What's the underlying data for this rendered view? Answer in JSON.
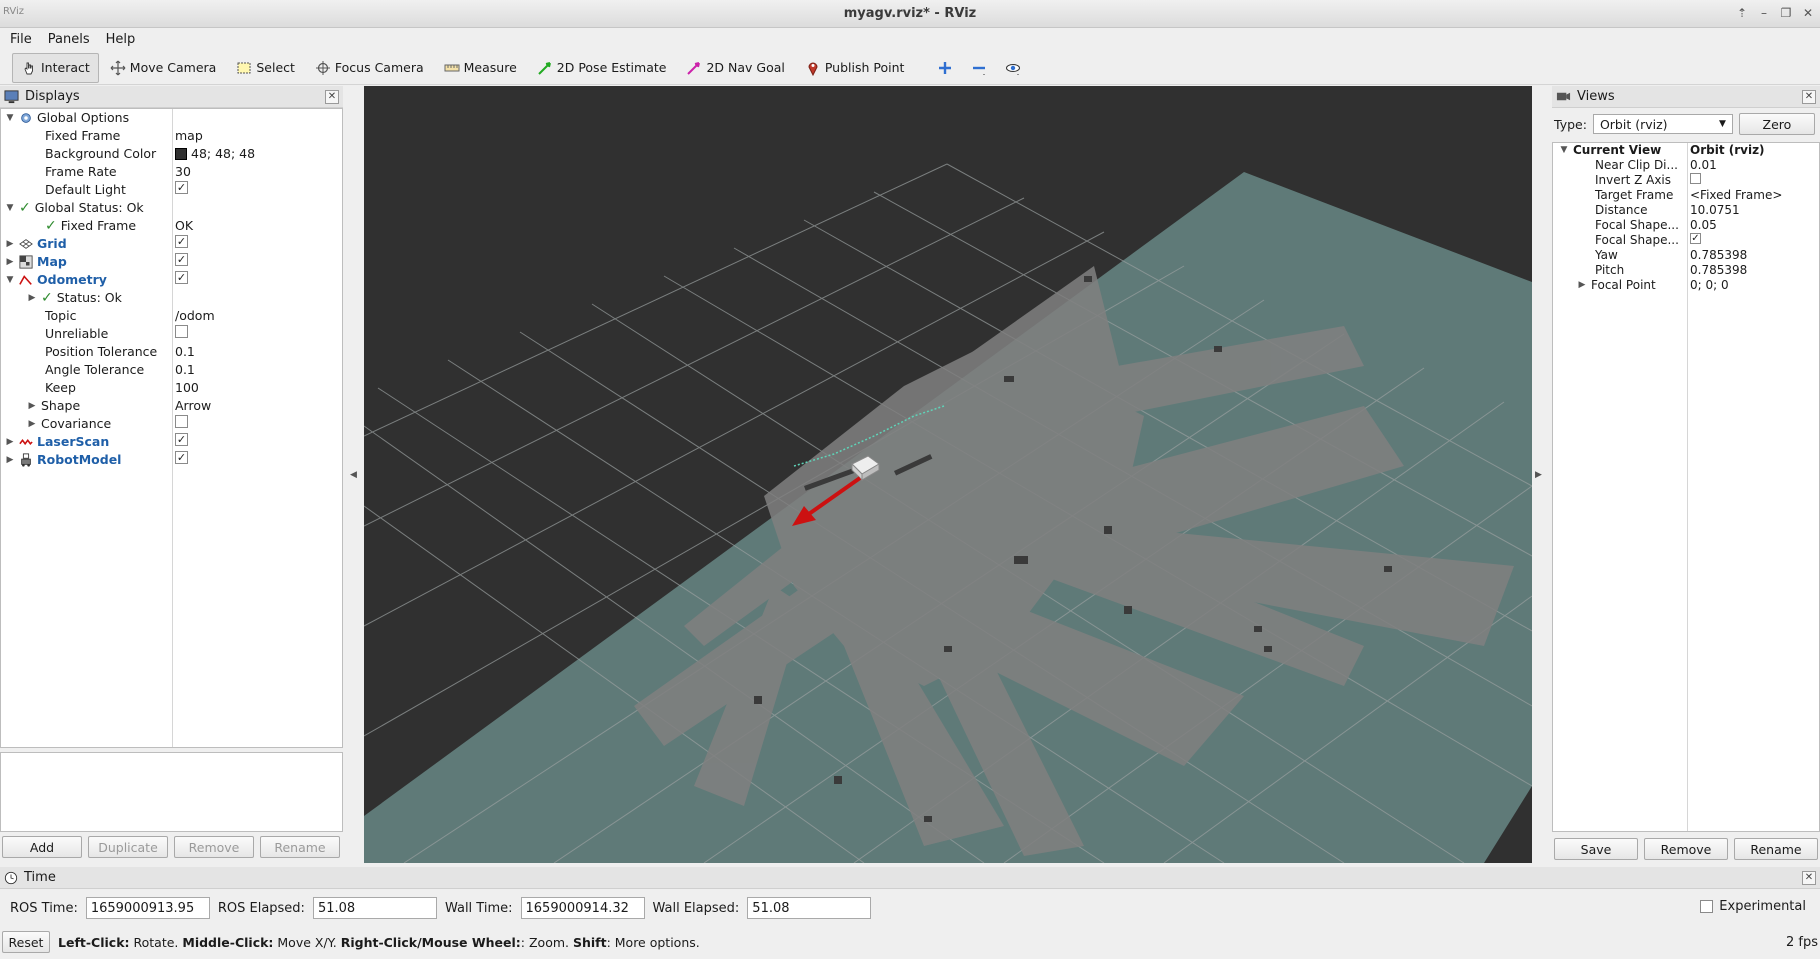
{
  "window": {
    "title": "myagv.rviz* - RViz",
    "app_icon_text": "RViz"
  },
  "menu": [
    "File",
    "Panels",
    "Help"
  ],
  "toolbar": {
    "tools": [
      {
        "label": "Interact",
        "icon": "hand-cursor-icon",
        "active": true
      },
      {
        "label": "Move Camera",
        "icon": "move-camera-icon"
      },
      {
        "label": "Select",
        "icon": "select-box-icon"
      },
      {
        "label": "Focus Camera",
        "icon": "focus-crosshair-icon"
      },
      {
        "label": "Measure",
        "icon": "ruler-icon"
      },
      {
        "label": "2D Pose Estimate",
        "icon": "green-arrow-icon"
      },
      {
        "label": "2D Nav Goal",
        "icon": "magenta-arrow-icon"
      },
      {
        "label": "Publish Point",
        "icon": "map-pin-icon"
      }
    ]
  },
  "displays": {
    "title": "Displays",
    "rows": [
      {
        "label": "Global Options",
        "value": ""
      },
      {
        "label": "Fixed Frame",
        "value": "map"
      },
      {
        "label": "Background Color",
        "value": "48; 48; 48"
      },
      {
        "label": "Frame Rate",
        "value": "30"
      },
      {
        "label": "Default Light",
        "value": ""
      },
      {
        "label": "Global Status: Ok",
        "value": ""
      },
      {
        "label": "Fixed Frame",
        "value": "OK"
      },
      {
        "label": "Grid",
        "value": ""
      },
      {
        "label": "Map",
        "value": ""
      },
      {
        "label": "Odometry",
        "value": ""
      },
      {
        "label": "Status: Ok",
        "value": ""
      },
      {
        "label": "Topic",
        "value": "/odom"
      },
      {
        "label": "Unreliable",
        "value": ""
      },
      {
        "label": "Position Tolerance",
        "value": "0.1"
      },
      {
        "label": "Angle Tolerance",
        "value": "0.1"
      },
      {
        "label": "Keep",
        "value": "100"
      },
      {
        "label": "Shape",
        "value": "Arrow"
      },
      {
        "label": "Covariance",
        "value": ""
      },
      {
        "label": "LaserScan",
        "value": ""
      },
      {
        "label": "RobotModel",
        "value": ""
      }
    ],
    "buttons": {
      "add": "Add",
      "duplicate": "Duplicate",
      "remove": "Remove",
      "rename": "Rename"
    }
  },
  "views": {
    "title": "Views",
    "type_label": "Type:",
    "type_value": "Orbit (rviz)",
    "zero": "Zero",
    "rows": [
      {
        "label": "Current View",
        "value": "Orbit (rviz)"
      },
      {
        "label": "Near Clip Di...",
        "value": "0.01"
      },
      {
        "label": "Invert Z Axis",
        "value": ""
      },
      {
        "label": "Target Frame",
        "value": "<Fixed Frame>"
      },
      {
        "label": "Distance",
        "value": "10.0751"
      },
      {
        "label": "Focal Shape...",
        "value": "0.05"
      },
      {
        "label": "Focal Shape...",
        "value": ""
      },
      {
        "label": "Yaw",
        "value": "0.785398"
      },
      {
        "label": "Pitch",
        "value": "0.785398"
      },
      {
        "label": "Focal Point",
        "value": "0; 0; 0"
      }
    ],
    "buttons": {
      "save": "Save",
      "remove": "Remove",
      "rename": "Rename"
    }
  },
  "time": {
    "title": "Time",
    "ros_time_label": "ROS Time:",
    "ros_time": "1659000913.95",
    "ros_elapsed_label": "ROS Elapsed:",
    "ros_elapsed": "51.08",
    "wall_time_label": "Wall Time:",
    "wall_time": "1659000914.32",
    "wall_elapsed_label": "Wall Elapsed:",
    "wall_elapsed": "51.08",
    "experimental": "Experimental"
  },
  "status": {
    "reset": "Reset",
    "hint_left_b": "Left-Click:",
    "hint_left": " Rotate. ",
    "hint_mid_b": "Middle-Click:",
    "hint_mid": " Move X/Y. ",
    "hint_right_b": "Right-Click/Mouse Wheel:",
    "hint_right": ": Zoom. ",
    "hint_shift_b": "Shift",
    "hint_shift": ": More options.",
    "fps": "2 fps"
  },
  "colors": {
    "background": "#303030",
    "map_free": "#5f7a78",
    "link": "#1f5fa8",
    "odometry_arrow": "#cc1111"
  }
}
